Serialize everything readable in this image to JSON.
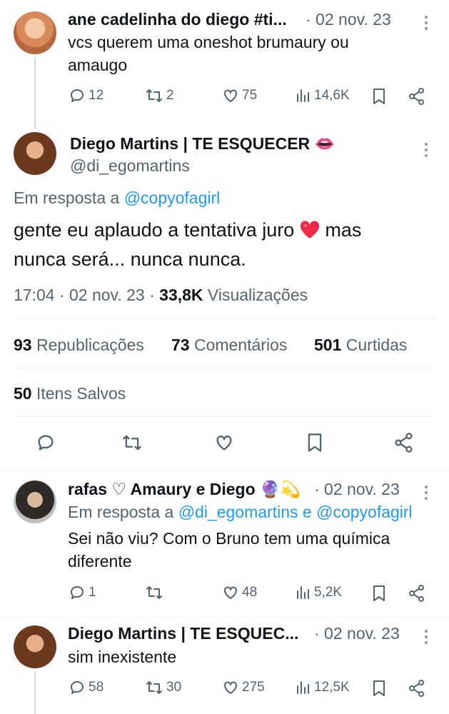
{
  "tweet1": {
    "name": "ane cadelinha do diego #ti...",
    "date": "· 02 nov. 23",
    "text_line1": "vcs querem uma oneshot brumaury ou",
    "text_line2": "amaugo",
    "replies": "12",
    "retweets": "2",
    "likes": "75",
    "views": "14,6K"
  },
  "main": {
    "name": "Diego Martins | TE ESQUECER",
    "name_emoji": "👄",
    "handle": "@di_egomartins",
    "reply_prefix": "Em resposta a",
    "reply_to": "@copyofagirl",
    "text_line1_a": "gente eu aplaudo a tentativa juro",
    "text_line1_b": "mas",
    "text_line2": "nunca será... nunca nunca.",
    "time": "17:04 · 02 nov. 23 ·",
    "views_count": "33,8K",
    "views_label": "Visualizações",
    "reposts_count": "93",
    "reposts_label": "Republicações",
    "comments_count": "73",
    "comments_label": "Comentários",
    "likes_count": "501",
    "likes_label": "Curtidas",
    "saved_count": "50",
    "saved_label": "Itens Salvos"
  },
  "reply1": {
    "name": "rafas ♡ Amaury e Diego",
    "name_emoji": "🔮💫",
    "date": "· 02 nov. 23",
    "reply_prefix": "Em resposta a",
    "reply_to_1": "@di_egomartins",
    "reply_and": "e",
    "reply_to_2": "@copyofagirl",
    "text_line1": "Sei não viu? Com o Bruno tem uma química",
    "text_line2": "diferente",
    "replies": "1",
    "retweets": "",
    "likes": "48",
    "views": "5,2K"
  },
  "reply2": {
    "name": "Diego Martins | TE ESQUEC...",
    "date": "· 02 nov. 23",
    "text": "sim inexistente",
    "replies": "58",
    "retweets": "30",
    "likes": "275",
    "views": "12,5K"
  }
}
